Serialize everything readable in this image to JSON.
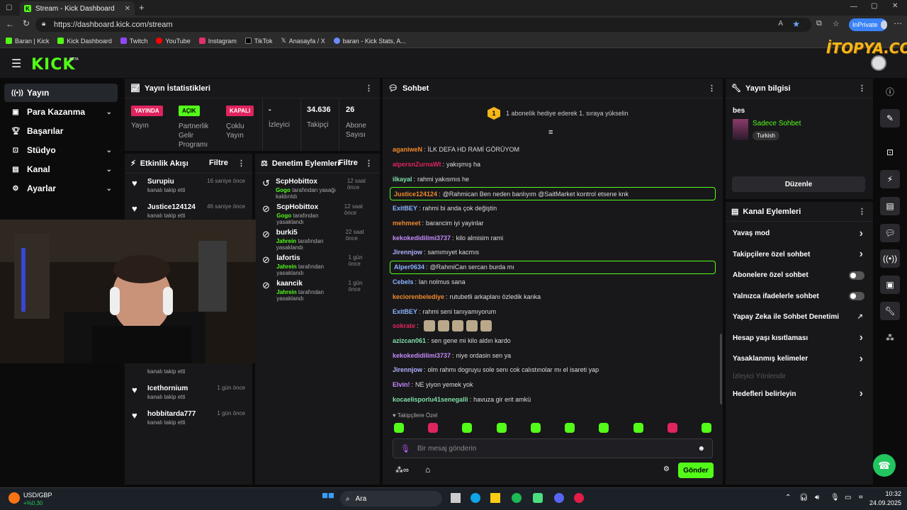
{
  "browser": {
    "tab_title": "Stream - Kick Dashboard",
    "url": "https://dashboard.kick.com/stream",
    "inprivate": "InPrivate",
    "bookmarks": [
      "Baran | Kick",
      "Kick Dashboard",
      "Twitch",
      "YouTube",
      "Instagram",
      "TikTok",
      "Anasayfa / X",
      "baran - Kick Stats, A..."
    ]
  },
  "watermark": "İTOPYA.COM",
  "logo": "KICK",
  "logo_beta": "BETA",
  "nav": [
    {
      "label": "Yayın",
      "icon": "broadcast-icon"
    },
    {
      "label": "Para Kazanma",
      "icon": "money-icon"
    },
    {
      "label": "Başarılar",
      "icon": "trophy-icon"
    },
    {
      "label": "Stüdyo",
      "icon": "studio-icon"
    },
    {
      "label": "Kanal",
      "icon": "channel-icon"
    },
    {
      "label": "Ayarlar",
      "icon": "gear-icon"
    }
  ],
  "stats": {
    "title": "Yayın İstatistikleri",
    "live_badge": "YAYINDA",
    "live_label": "Yayın",
    "partner_badge": "AÇIK",
    "partner_label": "Partnerlik Gelir Programı",
    "multi_badge": "KAPALI",
    "multi_label": "Çoklu Yayın",
    "viewers_value": "-",
    "viewers_label": "İzleyici",
    "followers_value": "34.636",
    "followers_label": "Takipçi",
    "subs_value": "26",
    "subs_label": "Abone Sayısı"
  },
  "activity": {
    "title": "Etkinlik Akışı",
    "filter": "Filtre",
    "items": [
      {
        "name": "Surupiu",
        "sub": "kanalı takip etti",
        "time": "16 saniye önce"
      },
      {
        "name": "Justice124124",
        "sub": "kanalı takip etti",
        "time": "46 saniye önce"
      },
      {
        "name": "Icethornium",
        "sub": "kanalı takip etti",
        "time": "1 gün önce"
      },
      {
        "name": "hobbitarda777",
        "sub": "kanalı takip etti",
        "time": "1 gün önce"
      }
    ],
    "hidden_sub": "kanalı takip etti"
  },
  "moderation": {
    "title": "Denetim Eylemleri",
    "filter": "Filtre",
    "items": [
      {
        "name": "ScpHobittox",
        "actor": "Gogo",
        "action": "tarafından yasağı kaldırıldı",
        "time": "12 saat önce"
      },
      {
        "name": "ScpHobittox",
        "actor": "Gogo",
        "action": "tarafından yasaklandı",
        "time": "12 saat önce"
      },
      {
        "name": "burki5",
        "actor": "Jahrein",
        "action": "tarafından yasaklandı",
        "time": "22 saat önce"
      },
      {
        "name": "lafortis",
        "actor": "Jahrein",
        "action": "tarafından yasaklandı",
        "time": "1 gün önce"
      },
      {
        "name": "kaancik",
        "actor": "Jahrein",
        "action": "tarafından yasaklandı",
        "time": "1 gün önce"
      }
    ]
  },
  "chat": {
    "title": "Sohbet",
    "gift_number": "1",
    "gift_text": "1 aboneIik hediye ederek 1. sıraya yükselin",
    "messages": [
      {
        "user": "aganiweN",
        "color": "#f08a2c",
        "text": "İLK DEFA HD RAMİ GÖRÜYOM",
        "hl": false
      },
      {
        "user": "alpersnZurnaWt",
        "color": "#e0245e",
        "text": "yakışmış ha",
        "hl": false
      },
      {
        "user": "ilkayal",
        "color": "#7fe0a8",
        "text": "rahmi yakısmıs he",
        "hl": false
      },
      {
        "user": "Justice124124",
        "color": "#f08a2c",
        "text": "@Rahmican Ben neden banlıyım @SaitMarket kontrol etsene knk",
        "hl": true
      },
      {
        "user": "ExitBEY",
        "color": "#8ab4ff",
        "text": "rahmi bi anda çok değiştin",
        "hl": false
      },
      {
        "user": "mehmeet",
        "color": "#f08a2c",
        "text": "barancim iyi yayinlar",
        "hl": false
      },
      {
        "user": "kekokedidilimi3737",
        "color": "#c58af9",
        "text": "kilo almisim rami",
        "hl": false
      },
      {
        "user": "Jirennjow",
        "color": "#b0b0ff",
        "text": "samımıyet kacmıs",
        "hl": false
      },
      {
        "user": "Alper0634",
        "color": "#8ab4ff",
        "text": "@RahmiCan sercan burda mı",
        "hl": true
      },
      {
        "user": "Cebels",
        "color": "#8ab4ff",
        "text": "lan nolmus sana",
        "hl": false
      },
      {
        "user": "keciorenbelediye",
        "color": "#f08a2c",
        "text": "rutubetli arkaplanı özledik kanka",
        "hl": false
      },
      {
        "user": "ExitBEY",
        "color": "#8ab4ff",
        "text": "rahmi seni tanıyamıyorum",
        "hl": false
      },
      {
        "user": "sokrate",
        "color": "#e0245e",
        "text": "",
        "hl": false
      },
      {
        "user": "azizcan061",
        "color": "#7fe0a8",
        "text": "sen gene mi kilo aldın kardo",
        "hl": false
      },
      {
        "user": "kekokedidilimi3737",
        "color": "#c58af9",
        "text": "niye ordasin sen ya",
        "hl": false
      },
      {
        "user": "Jirennjow",
        "color": "#b0b0ff",
        "text": "olm rahmı dogruyu sole senı cok calıstınolar mı el isareti yap",
        "hl": false
      },
      {
        "user": "Elvin!",
        "color": "#c58af9",
        "text": "NE yiyon yemek yok",
        "hl": false
      },
      {
        "user": "kocaelisporlu41senegalli",
        "color": "#7fe0a8",
        "text": "havuza gir erit amkü",
        "hl": false
      }
    ],
    "followers_only": "Takipçilere Özel",
    "input_placeholder": "Bir mesaj gönderin",
    "send": "Gönder"
  },
  "stream_info": {
    "title": "Yayın bilgisi",
    "stream_title": "bes",
    "category": "Sadece Sohbet",
    "language": "Turkish",
    "edit": "Düzenle"
  },
  "channel_actions": {
    "title": "Kanal Eylemleri",
    "items": [
      {
        "label": "Yavaş mod",
        "type": "chevron"
      },
      {
        "label": "Takipçilere özel sohbet",
        "type": "chevron"
      },
      {
        "label": "Abonelere özel sohbet",
        "type": "toggle"
      },
      {
        "label": "Yalnızca ifadelerle sohbet",
        "type": "toggle"
      },
      {
        "label": "Yapay Zeka ile Sohbet Denetimi",
        "type": "external"
      },
      {
        "label": "Hesap yaşı kısıtlaması",
        "type": "chevron"
      },
      {
        "label": "Yasaklanmış kelimeler",
        "type": "chevron"
      },
      {
        "label": "İzleyici Yönlendir",
        "type": "disabled"
      },
      {
        "label": "Hedefleri belirleyin",
        "type": "chevron"
      }
    ]
  },
  "taskbar": {
    "ticker_name": "USD/GBP",
    "ticker_value": "+%0,30",
    "search": "Ara",
    "time": "10:32",
    "date": "24.09.2025"
  }
}
